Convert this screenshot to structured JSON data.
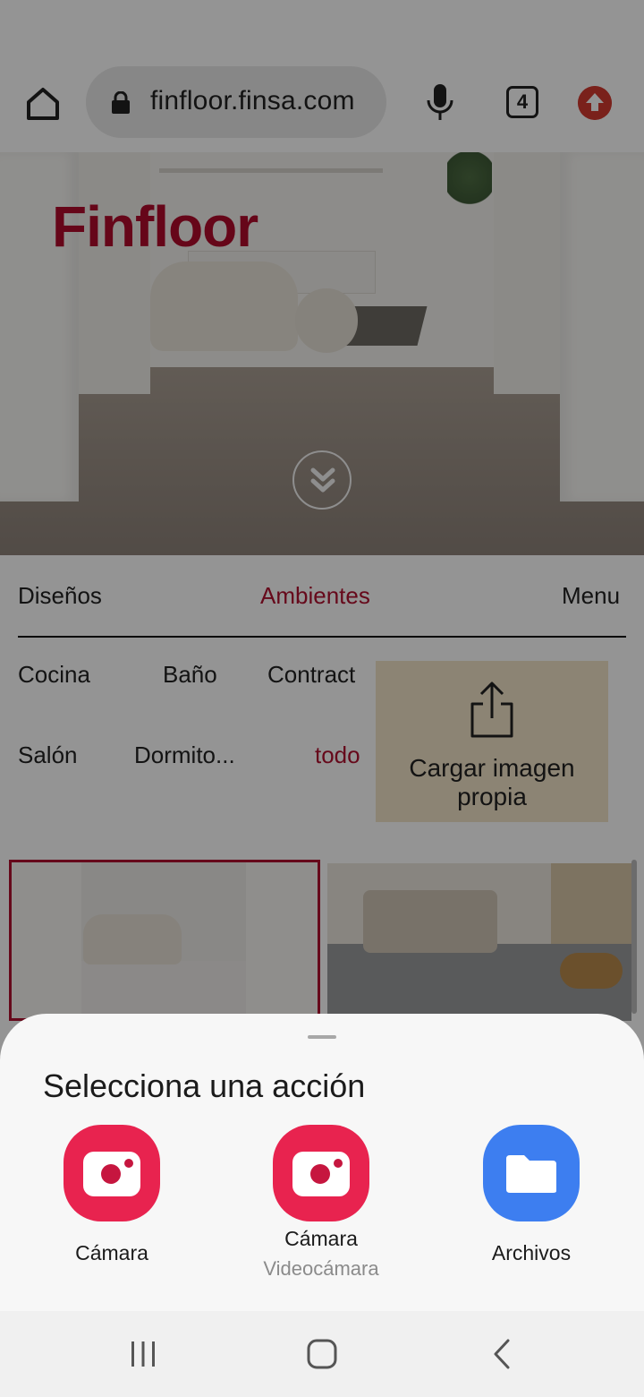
{
  "browser": {
    "url": "finfloor.finsa.com",
    "tab_count": "4",
    "icons": [
      "home-icon",
      "lock-icon",
      "microphone-icon",
      "tabs-icon",
      "update-icon"
    ]
  },
  "hero": {
    "logo": "Finfloor",
    "icons": [
      "chevron-double-down-icon"
    ]
  },
  "tabs": [
    {
      "label": "Diseños",
      "active": false
    },
    {
      "label": "Ambientes",
      "active": true
    },
    {
      "label": "Menu",
      "active": false
    }
  ],
  "subcategories": [
    {
      "label": "Cocina"
    },
    {
      "label": "Baño"
    },
    {
      "label": "Contract"
    },
    {
      "label": "Salón"
    },
    {
      "label": "Dormito..."
    },
    {
      "label": "todo",
      "active": true
    }
  ],
  "upload": {
    "label": "Cargar imagen propia",
    "icon": "share-upload-icon"
  },
  "sheet": {
    "title": "Selecciona una acción",
    "apps": [
      {
        "label": "Cámara",
        "sublabel": "",
        "icon": "camera-icon",
        "color": "#e8234f"
      },
      {
        "label": "Cámara",
        "sublabel": "Videocámara",
        "icon": "camera-icon",
        "color": "#e8234f"
      },
      {
        "label": "Archivos",
        "sublabel": "",
        "icon": "folder-icon",
        "color": "#3d7ef0"
      }
    ]
  },
  "navbar": {
    "icons": [
      "recent-apps-icon",
      "home-button-icon",
      "back-icon"
    ]
  },
  "colors": {
    "brand": "#b0102f",
    "upload_bg": "#f2e3c8",
    "scrim": "rgba(0,0,0,0.42)"
  }
}
